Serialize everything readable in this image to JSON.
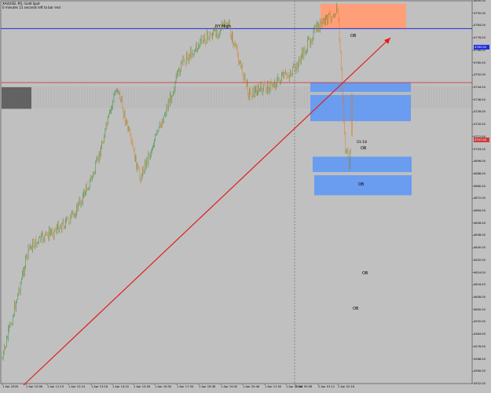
{
  "header": {
    "symbol_line": "XAUUSD, M1: Gold Spot",
    "timer_line": "0 minutes 15 seconds left to bar end"
  },
  "annotations": {
    "ny_high": "NY High",
    "ob_labels": [
      "OB",
      "OB",
      "OB",
      "OB",
      "OB"
    ],
    "countdown": "01:18"
  },
  "price_axis": {
    "ticks": [
      "4800.00",
      "4792.00",
      "4784.00",
      "4776.00",
      "4768.00",
      "4760.00",
      "4752.00",
      "4744.00",
      "4736.00",
      "4728.00",
      "4720.00",
      "4712.00",
      "4704.00",
      "4696.00",
      "4688.00",
      "4680.00",
      "4672.00",
      "4664.00",
      "4656.00",
      "4648.00",
      "4640.00",
      "4632.00",
      "4624.00",
      "4616.00",
      "4608.00",
      "4600.00",
      "4592.00",
      "4584.00",
      "4576.00",
      "4568.00",
      "4560.00",
      "4552.00"
    ],
    "blue_tag": "4782.00",
    "red_tag": "4747.00"
  },
  "time_axis": {
    "ticks": [
      "1 Apr 2026",
      "1 Apr 10:06",
      "1 Apr 11:10",
      "1 Apr 12:14",
      "1 Apr 13:18",
      "1 Apr 14:22",
      "1 Apr 15:26",
      "1 Apr 16:30",
      "1 Apr 17:34",
      "1 Apr 18:38",
      "1 Apr 19:42",
      "1 Apr 20:46",
      "1 Apr 21:50",
      "1 Apr 22:54",
      "2 Apr 00:08",
      "2 Apr 01:12",
      "2 Apr 02:16"
    ]
  },
  "colors": {
    "background": "#c0c0c0",
    "bull_candle": "#2e8b2e",
    "bear_candle": "#e07a1a",
    "trendline": "#e21c1c",
    "blue_line": "#1f2fe0",
    "red_line": "#d03a3a",
    "supply_zone": "#ff9f7a",
    "demand_zone": "#6a9cf0"
  },
  "chart_data": {
    "type": "candlestick",
    "symbol": "XAUUSD",
    "timeframe": "M1",
    "price_axis_range": [
      4552,
      4800
    ],
    "close_path": [
      {
        "t": "1 Apr 2026",
        "price": 4568
      },
      {
        "t": "1 Apr 10:06",
        "price": 4640
      },
      {
        "t": "1 Apr 11:10",
        "price": 4650
      },
      {
        "t": "1 Apr 12:14",
        "price": 4660
      },
      {
        "t": "1 Apr 13:18",
        "price": 4690
      },
      {
        "t": "1 Apr 14:22",
        "price": 4745
      },
      {
        "t": "1 Apr 15:26",
        "price": 4685
      },
      {
        "t": "1 Apr 16:30",
        "price": 4720
      },
      {
        "t": "1 Apr 17:34",
        "price": 4760
      },
      {
        "t": "1 Apr 18:38",
        "price": 4775
      },
      {
        "t": "1 Apr 19:42",
        "price": 4785
      },
      {
        "t": "1 Apr 20:46",
        "price": 4740
      },
      {
        "t": "1 Apr 21:50",
        "price": 4745
      },
      {
        "t": "1 Apr 22:54",
        "price": 4755
      },
      {
        "t": "2 Apr 00:08",
        "price": 4780
      },
      {
        "t": "2 Apr 01:12",
        "price": 4795
      },
      {
        "t": "2 Apr 02:16",
        "price": 4700
      }
    ],
    "horizontal_lines": [
      {
        "name": "blue",
        "price": 4782
      },
      {
        "name": "red",
        "price": 4747
      }
    ],
    "zones": [
      {
        "label": "OB",
        "kind": "supply",
        "price_top": 4798,
        "price_bottom": 4782
      },
      {
        "label": "OB",
        "kind": "demand",
        "price_top": 4747,
        "price_bottom": 4741
      },
      {
        "label": "OB",
        "kind": "demand",
        "price_top": 4739,
        "price_bottom": 4722
      },
      {
        "label": "OB",
        "kind": "demand",
        "price_top": 4699,
        "price_bottom": 4689
      },
      {
        "label": "OB",
        "kind": "demand",
        "price_top": 4687,
        "price_bottom": 4674
      }
    ]
  }
}
